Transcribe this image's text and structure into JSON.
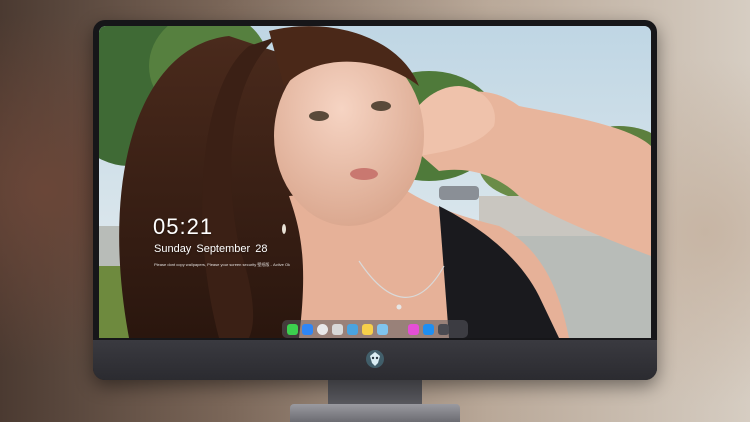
{
  "lockscreen": {
    "time": "05:21",
    "date": "Sunday September  28",
    "notice": "Please dont copy wallpapers, Please your screen security 壁纸版 - Active Ok"
  },
  "dock": {
    "apps": [
      {
        "icon": "messages-icon",
        "color": "#3ccf4e"
      },
      {
        "icon": "finder-icon",
        "color": "#2f86f6"
      },
      {
        "icon": "safari-icon",
        "color": "#e8e8ea"
      },
      {
        "icon": "notes-icon",
        "color": "#d8d8d8"
      },
      {
        "icon": "clapper-icon",
        "color": "#4aa3df"
      },
      {
        "icon": "stickies-icon",
        "color": "#f7d04a"
      },
      {
        "icon": "photos-icon",
        "color": "#7fc4ef"
      },
      {
        "icon": "itunes-icon",
        "color": "#e44fd6"
      },
      {
        "icon": "app-store-icon",
        "color": "#1f8ef1"
      },
      {
        "icon": "camera-icon",
        "color": "#4b4b52"
      }
    ]
  },
  "colors": {
    "bezel": "#161619",
    "chin": "#2f2f34",
    "text": "#ffffff"
  }
}
